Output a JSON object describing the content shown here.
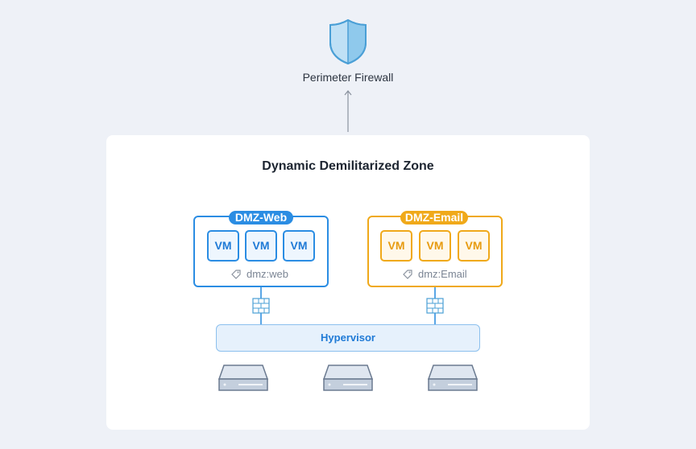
{
  "firewall": {
    "label": "Perimeter Firewall",
    "icon": "shield-icon"
  },
  "dmz": {
    "title": "Dynamic Demilitarized Zone"
  },
  "groups": [
    {
      "name": "DMZ-Web",
      "tag": "dmz:web",
      "color": "#2b8de3",
      "vms": [
        "VM",
        "VM",
        "VM"
      ]
    },
    {
      "name": "DMZ-Email",
      "tag": "dmz:Email",
      "color": "#f0a91a",
      "vms": [
        "VM",
        "VM",
        "VM"
      ]
    }
  ],
  "hypervisor": {
    "label": "Hypervisor"
  },
  "servers": {
    "count": 3,
    "icon": "server-icon"
  },
  "colors": {
    "background": "#eef1f7",
    "panel": "#ffffff",
    "web": "#2b8de3",
    "email": "#f0a91a"
  }
}
